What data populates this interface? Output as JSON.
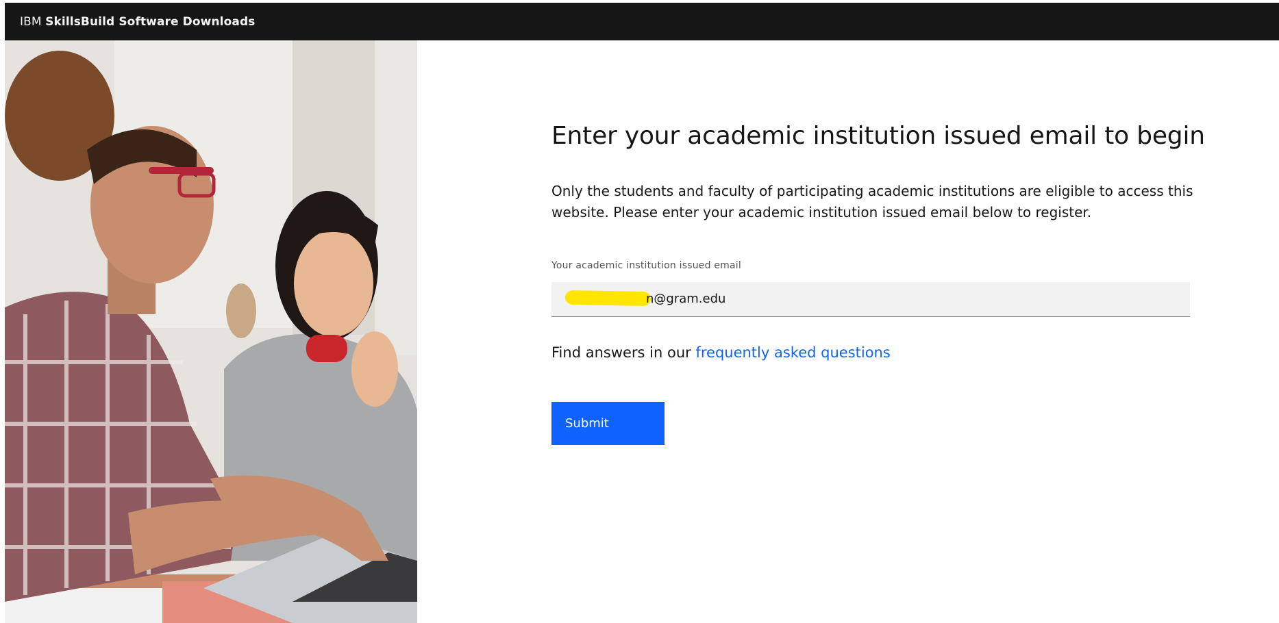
{
  "header": {
    "brand_prefix": "IBM",
    "brand_name": "SkillsBuild Software Downloads"
  },
  "main": {
    "heading": "Enter your academic institution issued email to begin",
    "intro": "Only the students and faculty of participating academic institutions are eligible to access this website. Please enter your academic institution issued email below to register.",
    "email_label": "Your academic institution issued email",
    "email_value": "n@gram.edu",
    "faq_prefix": "Find answers in our ",
    "faq_link": "frequently asked questions",
    "submit_label": "Submit"
  },
  "colors": {
    "topbar_bg": "#161616",
    "primary": "#0f62fe",
    "redaction": "#ffe600"
  }
}
